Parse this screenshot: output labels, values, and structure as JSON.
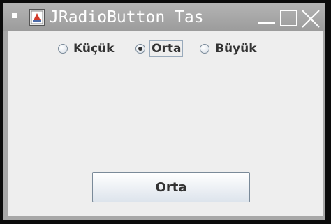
{
  "window": {
    "title": "JRadioButton Tas"
  },
  "radios": {
    "items": [
      {
        "label": "Küçük",
        "selected": false
      },
      {
        "label": "Orta",
        "selected": true
      },
      {
        "label": "Büyük",
        "selected": false
      }
    ]
  },
  "output_button": {
    "label": "Orta"
  },
  "icons": {
    "window_menu": "window-menu-icon",
    "app": "java-app-icon",
    "minimize": "minimize-icon",
    "maximize": "maximize-icon",
    "close": "close-icon"
  },
  "colors": {
    "titlebar": "#a7a7a7",
    "content_bg": "#eeeeee",
    "text": "#333333"
  }
}
